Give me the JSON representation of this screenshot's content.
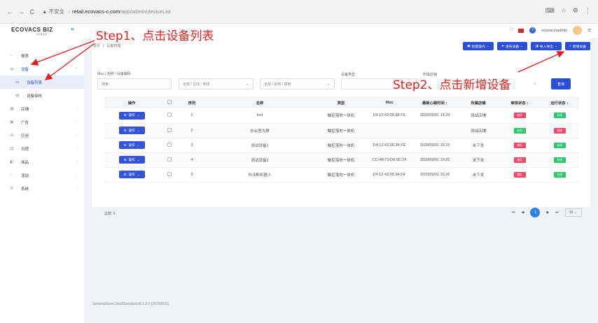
{
  "browser": {
    "back": "←",
    "forward": "→",
    "reload": "C",
    "security": "▲ 不安全",
    "host": "retail.ecovacs-c.com",
    "path": "/app/admin/deviceList",
    "right_icons": [
      "⌨",
      "☆",
      "⚙",
      "⋮"
    ]
  },
  "sidebar": {
    "logo": "ECOVACS BIZ",
    "logo_sub": "科沃斯商用",
    "collapse": "«",
    "items": [
      {
        "label": "报表",
        "icon": "chart-icon"
      },
      {
        "label": "设备",
        "icon": "device-icon"
      },
      {
        "label": "设备列表",
        "icon": "list-icon"
      },
      {
        "label": "设备审核",
        "icon": "audit-icon"
      },
      {
        "label": "店铺",
        "icon": "store-icon"
      },
      {
        "label": "广告",
        "icon": "ad-icon"
      },
      {
        "label": "应用",
        "icon": "app-icon"
      },
      {
        "label": "日程",
        "icon": "calendar-icon"
      },
      {
        "label": "商品",
        "icon": "goods-icon"
      },
      {
        "label": "活动",
        "icon": "activity-icon"
      },
      {
        "label": "系统",
        "icon": "system-icon"
      }
    ]
  },
  "topbar": {
    "user": "ecovacs\\admin",
    "notify_count": "2"
  },
  "breadcrumb": {
    "home": "首页",
    "current": "设备管理"
  },
  "actions": {
    "batch": "批量操作",
    "publish": "发布设备",
    "export": "导入导出",
    "add": "新增设备"
  },
  "filters": {
    "search_label": "Mac / 名称 / 设备编码",
    "search_placeholder": "搜索...",
    "status_select": "全部 / 在线 / 离线",
    "enable_select": "全部 / 启用 / 禁用",
    "type_label": "设备类型",
    "store_label": "所属店铺",
    "query": "查询"
  },
  "table": {
    "headers": [
      "操作",
      "",
      "序列",
      "名称",
      "类型",
      "Mac",
      "最新心跳时间 ↕",
      "所属店铺",
      "审核状态 ↕",
      "运行状态 ↕"
    ],
    "op_label": "操作",
    "rows": [
      {
        "seq": "1",
        "name": "test",
        "type": "触控落地一体机",
        "mac": "D4:12:43:08:3A:FE",
        "heartbeat": "2020/09/01 14:29",
        "store": "测试店铺",
        "store_style": "muted",
        "audit": "禁用",
        "audit_color": "red",
        "run": "在线",
        "run_color": "green"
      },
      {
        "seq": "2",
        "name": "办公室大屏",
        "type": "触控落地一体机",
        "mac": "",
        "heartbeat": "",
        "store": "测试店铺",
        "store_style": "muted",
        "audit": "启用",
        "audit_color": "green",
        "run": "离线",
        "run_color": "red"
      },
      {
        "seq": "3",
        "name": "测试设备1",
        "type": "触控落地一体机",
        "mac": "D4:12:43:08:3A:FE",
        "heartbeat": "2020/09/01 15:26",
        "store": "未下发",
        "store_style": "orange",
        "audit": "禁用",
        "audit_color": "red",
        "run": "在线",
        "run_color": "green"
      },
      {
        "seq": "4",
        "name": "测试设备2",
        "type": "触控落地一体机",
        "mac": "CC:4B:73:D8:0C:24",
        "heartbeat": "2020/09/01 15:26",
        "store": "未下发",
        "store_style": "orange",
        "audit": "禁用",
        "audit_color": "red",
        "run": "在线",
        "run_color": "green"
      },
      {
        "seq": "5",
        "name": "科沃斯机器人",
        "type": "触控落地一体机",
        "mac": "D4:12:43:08:3A:FE",
        "heartbeat": "2020/09/01 15:26",
        "store": "未下发",
        "store_style": "orange",
        "audit": "禁用",
        "audit_color": "red",
        "run": "在线",
        "run_color": "green"
      }
    ]
  },
  "pagination": {
    "total": "总数: 5",
    "first": "⏮",
    "prev": "◀",
    "current": "1",
    "next": "▶",
    "last": "⏭",
    "size": "10"
  },
  "footer": "SensingStoreCloudStandard v8.1.0.0 [20200831]",
  "annotations": {
    "step1": "Step1、点击设备列表",
    "step2": "Step2、点击新增设备"
  },
  "colors": {
    "accent": "#2a4fd4",
    "danger": "#f04869",
    "success": "#2fc66f",
    "annotation": "#e81e1e"
  }
}
